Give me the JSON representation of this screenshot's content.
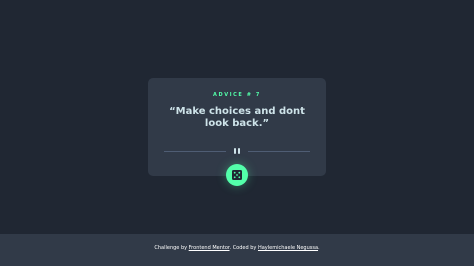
{
  "card": {
    "advice_label": "ADVICE # 7",
    "quote": "“Make choices and dont look back.”"
  },
  "dice_button": {
    "icon": "dice-icon"
  },
  "footer": {
    "prefix": "Challenge by ",
    "challenge_link": "Frontend Mentor",
    "middle": ". Coded by ",
    "author_link": "Haylemichaele Negussa",
    "suffix": "."
  },
  "colors": {
    "background": "#202733",
    "card": "#313a48",
    "accent": "#53ffaa",
    "quote_text": "#cee3e9",
    "divider": "#4f5d74"
  }
}
